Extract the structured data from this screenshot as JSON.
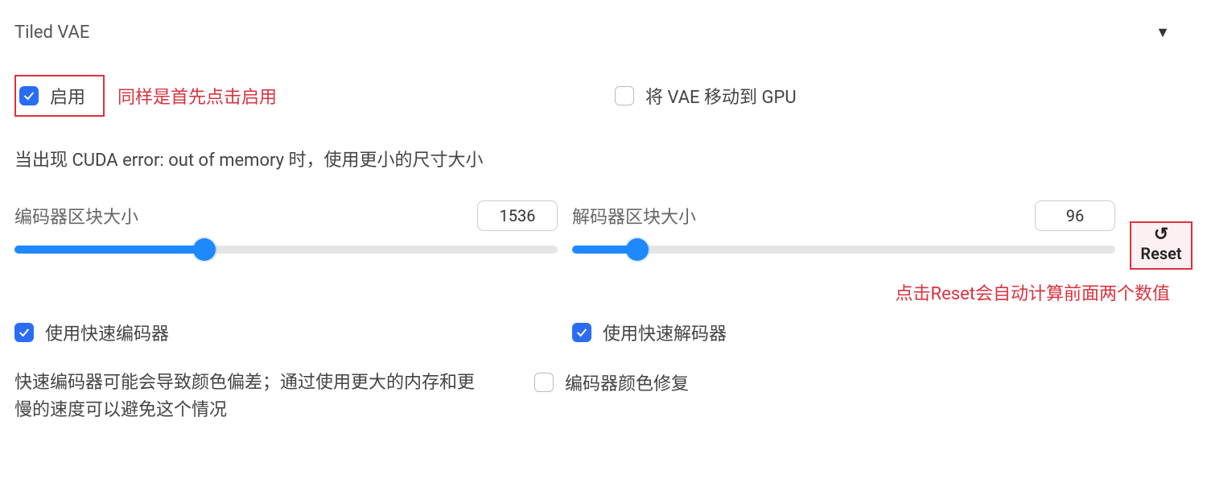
{
  "section": {
    "title": "Tiled VAE"
  },
  "enable": {
    "label": "启用",
    "checked": true
  },
  "annotations": {
    "enable_first": "同样是首先点击启用",
    "reset_explain": "点击Reset会自动计算前面两个数值"
  },
  "gpu": {
    "label": "将 VAE 移动到 GPU",
    "checked": false
  },
  "help": "当出现 CUDA error: out of memory 时，使用更小的尺寸大小",
  "encoder_tile": {
    "label": "编码器区块大小",
    "value": "1536",
    "fill_pct": 35
  },
  "decoder_tile": {
    "label": "解码器区块大小",
    "value": "96",
    "fill_pct": 12
  },
  "reset": {
    "label": "Reset",
    "icon": "↺"
  },
  "fast_encoder": {
    "label": "使用快速编码器",
    "checked": true
  },
  "fast_decoder": {
    "label": "使用快速解码器",
    "checked": true
  },
  "warn_text": "快速编码器可能会导致颜色偏差；通过使用更大的内存和更慢的速度可以避免这个情况",
  "color_fix": {
    "label": "编码器颜色修复",
    "checked": false
  }
}
